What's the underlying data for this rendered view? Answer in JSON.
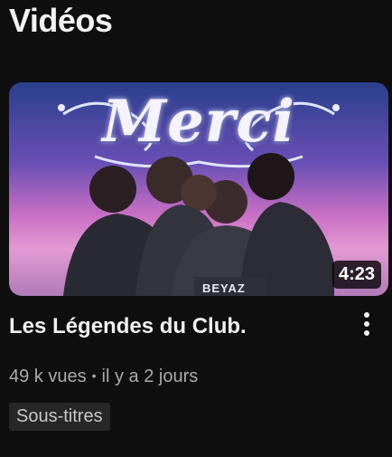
{
  "section": {
    "title": "Vidéos"
  },
  "video": {
    "thumbnail_title": "Merci",
    "thumbnail_jersey": "BEYAZ",
    "duration": "4:23",
    "title": "Les Légendes du Club.",
    "views": "49 k vues",
    "separator": "•",
    "age": "il y a 2 jours",
    "badge": "Sous-titres",
    "more_icon": "more-vert-icon"
  },
  "colors": {
    "background": "#0f0f0f",
    "text_primary": "#f1f1f1",
    "text_secondary": "#aaaaaa",
    "badge_bg": "#272727"
  }
}
